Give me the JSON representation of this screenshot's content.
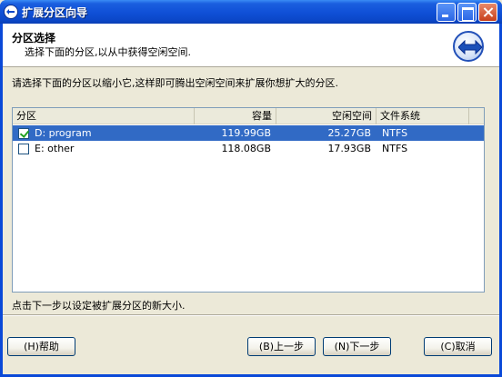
{
  "window": {
    "title": "扩展分区向导"
  },
  "header": {
    "title": "分区选择",
    "subtitle": "选择下面的分区,以从中获得空闲空间."
  },
  "instruction": "请选择下面的分区以缩小它,这样即可腾出空闲空间来扩展你想扩大的分区.",
  "table": {
    "columns": {
      "name": "分区",
      "capacity": "容量",
      "free": "空闲空间",
      "fs": "文件系统"
    },
    "rows": [
      {
        "checked": true,
        "selected": true,
        "name": "D: program",
        "capacity": "119.99GB",
        "free": "25.27GB",
        "fs": "NTFS"
      },
      {
        "checked": false,
        "selected": false,
        "name": "E: other",
        "capacity": "118.08GB",
        "free": "17.93GB",
        "fs": "NTFS"
      }
    ]
  },
  "hint": "点击下一步以设定被扩展分区的新大小.",
  "buttons": {
    "help": "(H)帮助",
    "back": "(B)上一步",
    "next": "(N)下一步",
    "cancel": "(C)取消"
  },
  "icons": {
    "title_icon": "wizard-arrows-icon",
    "header_icon": "expand-arrows-icon",
    "minimize": "minimize-icon",
    "maximize": "maximize-icon",
    "close": "close-icon",
    "checkbox": "checkbox-icon"
  },
  "colors": {
    "titlebar": "#0b47c8",
    "selection": "#316ac5",
    "close": "#c8401c"
  }
}
